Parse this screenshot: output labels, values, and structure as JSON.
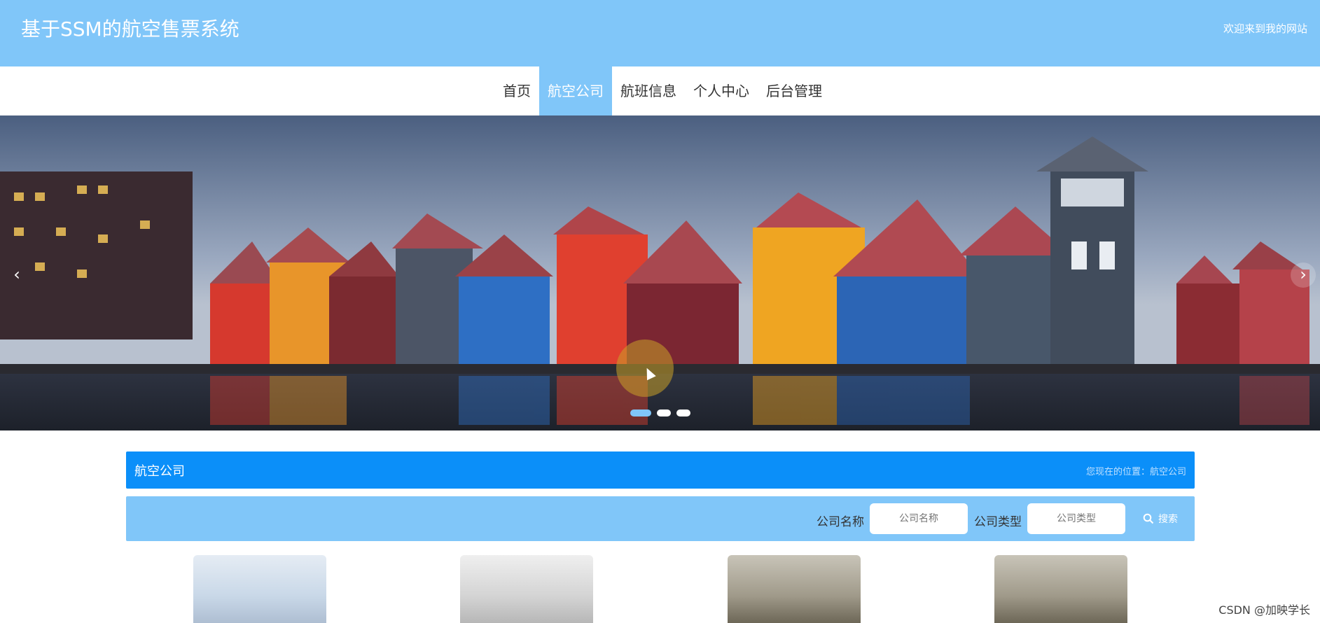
{
  "header": {
    "site_title": "基于SSM的航空售票系统",
    "welcome": "欢迎来到我的网站"
  },
  "nav": {
    "items": [
      {
        "label": "首页"
      },
      {
        "label": "航空公司",
        "active": true
      },
      {
        "label": "航班信息"
      },
      {
        "label": "个人中心"
      },
      {
        "label": "后台管理"
      }
    ]
  },
  "banner": {
    "prev_glyph": "‹",
    "next_glyph": "›",
    "slides": 3,
    "active_slide": 1
  },
  "section": {
    "title": "航空公司",
    "breadcrumb": "您现在的位置：航空公司"
  },
  "search": {
    "company_name_label": "公司名称",
    "company_name_placeholder": "公司名称",
    "company_type_label": "公司类型",
    "company_type_placeholder": "公司类型",
    "search_label": "搜索"
  },
  "watermark": "CSDN @加映学长",
  "colors": {
    "header_bg": "#80c6f9",
    "section_bar_bg": "#0b8ff9",
    "search_bar_bg": "#80c6f9"
  }
}
